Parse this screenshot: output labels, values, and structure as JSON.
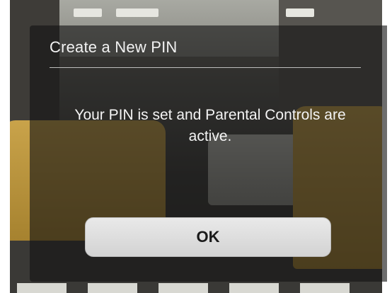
{
  "dialog": {
    "title": "Create a New PIN",
    "message": "Your PIN is set and Parental Controls are active.",
    "ok_label": "OK"
  },
  "colors": {
    "overlay": "#141414",
    "text": "#f4f4f4",
    "button_bg": "#dedede",
    "button_text": "#1a1a1a"
  }
}
